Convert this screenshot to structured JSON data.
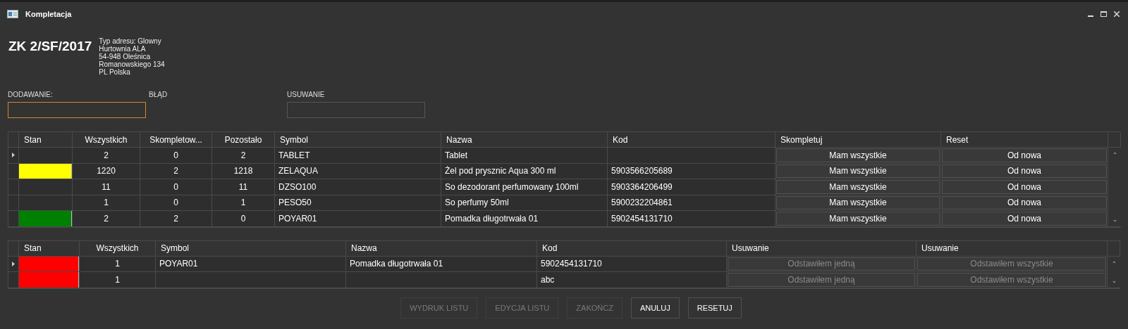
{
  "window": {
    "title": "Kompletacja"
  },
  "order": {
    "number": "ZK 2/SF/2017",
    "address": [
      "Typ adresu: Glowny",
      "Hurtownia ALA",
      "54-948 Oleśnica",
      "Romanowskiego 134",
      "PL Polska"
    ]
  },
  "fields": [
    {
      "label": "DODAWANIE:",
      "kind": "input",
      "focused": true
    },
    {
      "label": "BŁĄD",
      "kind": "label"
    },
    {
      "label": "USUWANIE",
      "kind": "input",
      "focused": false
    }
  ],
  "grids": [
    {
      "columns": [
        "Stan",
        "Wszystkich",
        "Skompletow...",
        "Pozostało",
        "Symbol",
        "Nazwa",
        "Kod",
        "Skompletuj",
        "Reset"
      ],
      "actions_disabled": false,
      "rows": [
        {
          "current": true,
          "cells": [
            "",
            "2",
            "0",
            "2",
            "TABLET",
            "Tablet",
            "",
            "Mam wszystkie",
            "Od nowa"
          ]
        },
        {
          "current": false,
          "color": "#ffff00",
          "cells": [
            "",
            "1220",
            "2",
            "1218",
            "ZELAQUA",
            "Żel pod prysznic Aqua 300 ml",
            "5903566205689",
            "Mam wszystkie",
            "Od nowa"
          ]
        },
        {
          "current": false,
          "cells": [
            "",
            "11",
            "0",
            "11",
            "DZSO100",
            "So dezodorant perfumowany 100ml",
            "5903364206499",
            "Mam wszystkie",
            "Od nowa"
          ]
        },
        {
          "current": false,
          "cells": [
            "",
            "1",
            "0",
            "1",
            "PESO50",
            "So perfumy 50ml",
            "5900232204861",
            "Mam wszystkie",
            "Od nowa"
          ]
        },
        {
          "current": false,
          "color": "#008000",
          "cells": [
            "",
            "2",
            "2",
            "0",
            "POYAR01",
            "Pomadka długotrwała 01",
            "5902454131710",
            "Mam wszystkie",
            "Od nowa"
          ]
        }
      ]
    },
    {
      "columns": [
        "Stan",
        "Wszystkich",
        "Symbol",
        "Nazwa",
        "Kod",
        "Usuwanie",
        "Usuwanie"
      ],
      "actions_disabled": true,
      "rows": [
        {
          "current": true,
          "color": "#ff0000",
          "cells": [
            "",
            "1",
            "POYAR01",
            "Pomadka długotrwała 01",
            "5902454131710",
            "Odstawiłem jedną",
            "Odstawiłem wszystkie"
          ]
        },
        {
          "current": false,
          "color": "#ff0000",
          "cells": [
            "",
            "1",
            "",
            "",
            "abc",
            "Odstawiłem jedną",
            "Odstawiłem wszystkie"
          ]
        }
      ]
    }
  ],
  "buttons": [
    {
      "label": "WYDRUK LISTU",
      "disabled": true
    },
    {
      "label": "EDYCJA LISTU",
      "disabled": true
    },
    {
      "label": "ZAKOŃCZ",
      "disabled": true
    },
    {
      "label": "ANULUJ",
      "disabled": false
    },
    {
      "label": "RESETUJ",
      "disabled": false
    }
  ]
}
